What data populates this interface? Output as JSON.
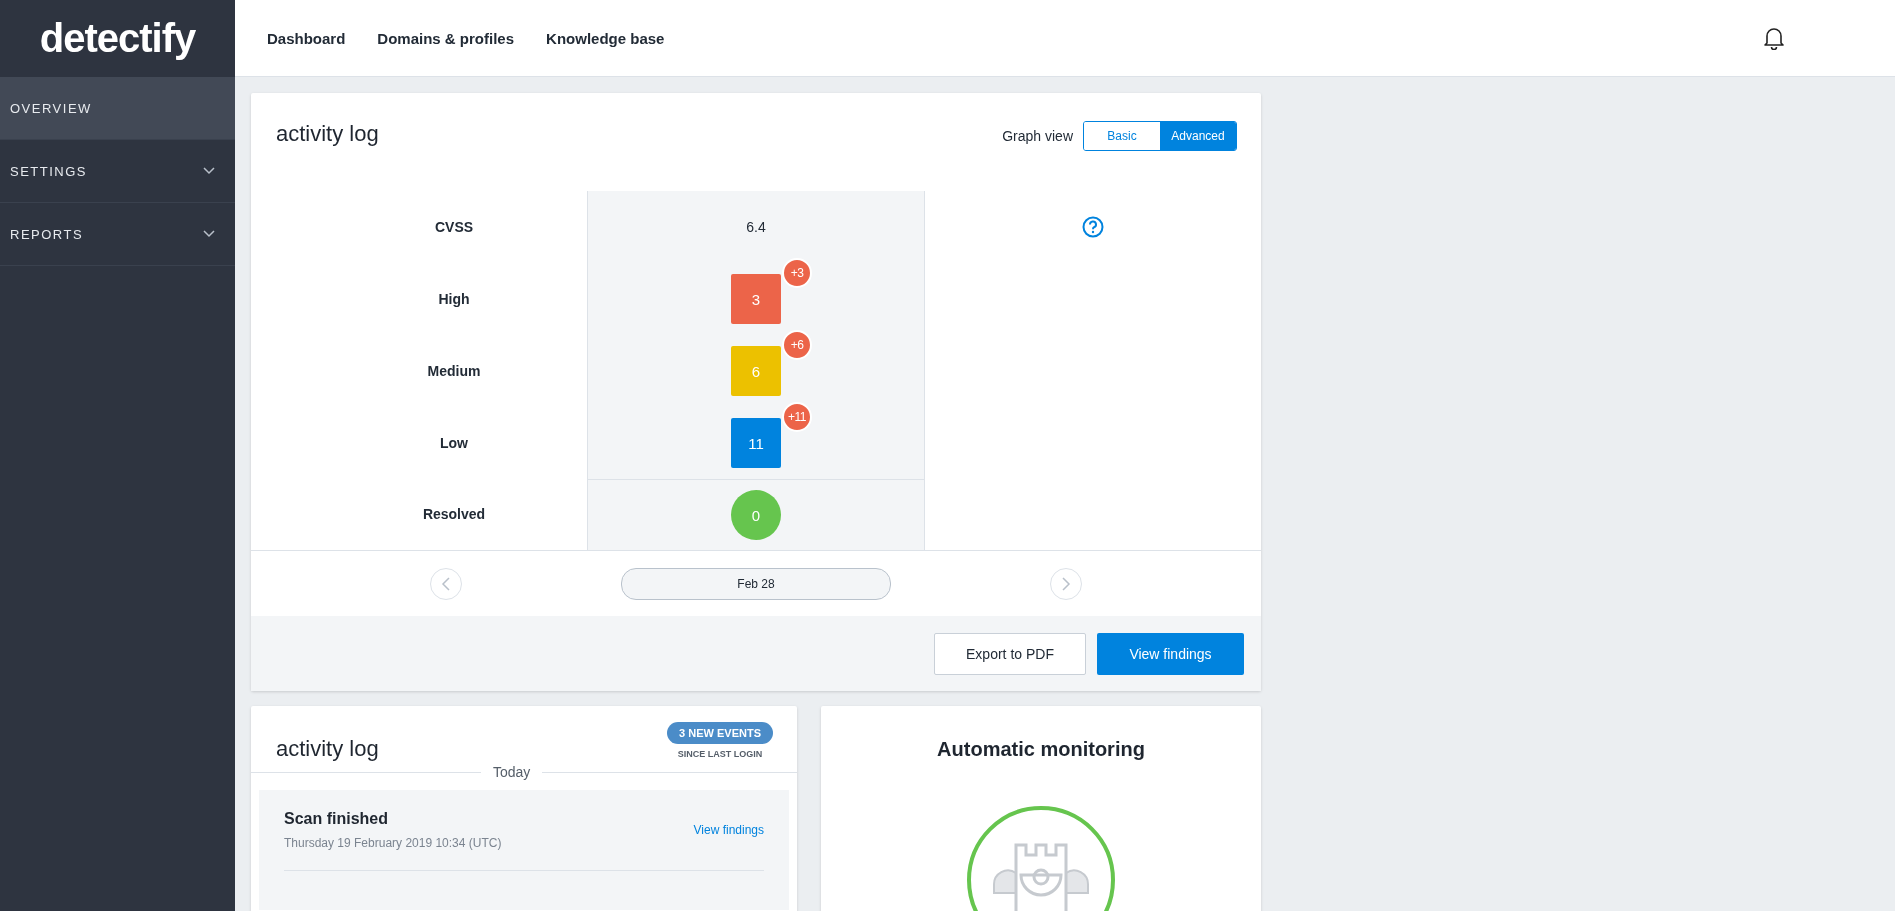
{
  "logo": "detectify",
  "top_nav": [
    {
      "label": "Dashboard"
    },
    {
      "label": "Domains & profiles"
    },
    {
      "label": "Knowledge base"
    }
  ],
  "sidebar": {
    "items": [
      {
        "label": "OVERVIEW",
        "selected": true,
        "expandable": false
      },
      {
        "label": "SETTINGS",
        "selected": false,
        "expandable": true
      },
      {
        "label": "REPORTS",
        "selected": false,
        "expandable": true
      }
    ]
  },
  "overview_card": {
    "title": "activity log",
    "graph_view": {
      "label": "Graph view",
      "options": [
        {
          "label": "Basic",
          "selected": false
        },
        {
          "label": "Advanced",
          "selected": true
        }
      ]
    },
    "cvss": {
      "label": "CVSS",
      "value": "6.4"
    },
    "severities": [
      {
        "label": "High",
        "count": "3",
        "delta": "+3",
        "color": "#ec6449"
      },
      {
        "label": "Medium",
        "count": "6",
        "delta": "+6",
        "color": "#ecc100"
      },
      {
        "label": "Low",
        "count": "11",
        "delta": "+11",
        "color": "#0083de"
      }
    ],
    "resolved": {
      "label": "Resolved",
      "count": "0"
    },
    "date": "Feb 28",
    "buttons": [
      {
        "label": "Export to PDF",
        "kind": "secondary"
      },
      {
        "label": "View findings",
        "kind": "primary"
      }
    ]
  },
  "activity_card": {
    "title": "activity log",
    "badge": "3 NEW EVENTS",
    "badge_caption": "SINCE LAST LOGIN",
    "day": "Today",
    "events": [
      {
        "title": "Scan finished",
        "time": "Thursday 19 February 2019 10:34 (UTC)",
        "link": "View findings"
      }
    ]
  },
  "monitoring_card": {
    "title": "Automatic monitoring"
  }
}
